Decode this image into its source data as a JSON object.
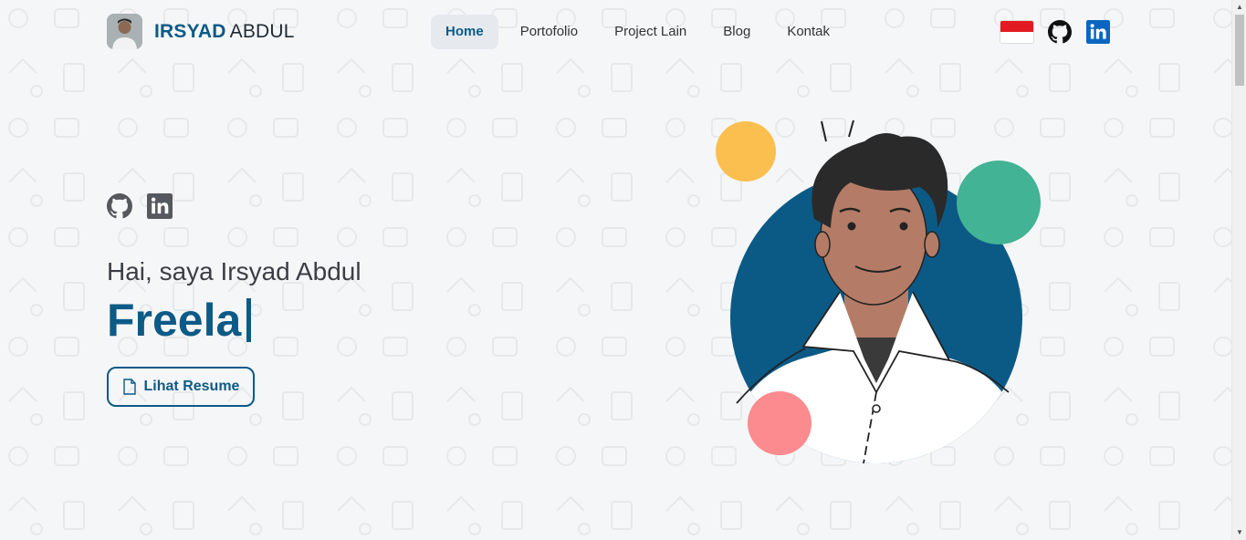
{
  "brand": {
    "first": "IRSYAD",
    "last": "ABDUL"
  },
  "nav": {
    "items": [
      {
        "label": "Home",
        "active": true
      },
      {
        "label": "Portofolio",
        "active": false
      },
      {
        "label": "Project Lain",
        "active": false
      },
      {
        "label": "Blog",
        "active": false
      },
      {
        "label": "Kontak",
        "active": false
      }
    ]
  },
  "header_icons": [
    "indonesia-flag-icon",
    "github-icon",
    "linkedin-icon"
  ],
  "hero": {
    "greeting": "Hai, saya Irsyad Abdul",
    "typed_text": "Freela",
    "resume_label": "Lihat Resume",
    "socials": [
      "github-icon",
      "linkedin-icon"
    ]
  },
  "colors": {
    "primary": "#0d5a86",
    "yellow": "#fbbf4f",
    "green": "#42b394",
    "pink": "#fb8b8f",
    "background": "#f5f6f8"
  }
}
